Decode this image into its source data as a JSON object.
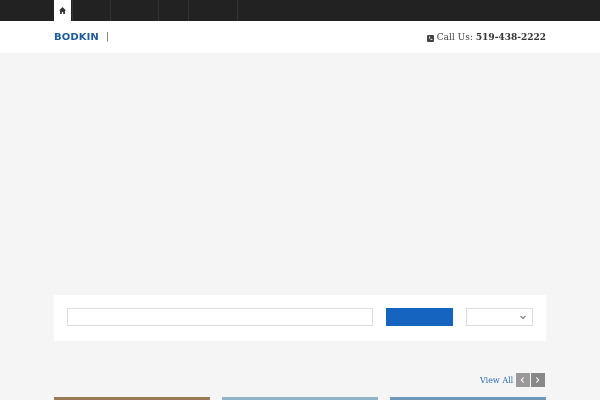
{
  "topnav": {
    "home_icon": "home-icon",
    "items": [
      "",
      "",
      "",
      "",
      ""
    ]
  },
  "header": {
    "logo": "BODKIN",
    "separator": "|",
    "phone_icon": "phone-icon",
    "phone_label": "Call Us:",
    "phone_number": "519-438-2222"
  },
  "search": {
    "input_value": "",
    "placeholder": "",
    "button_label": "",
    "select_value": "",
    "select_icon": "chevron-down-icon"
  },
  "listings": {
    "view_all": "View All",
    "prev_icon": "chevron-left-icon",
    "next_icon": "chevron-right-icon"
  },
  "colors": {
    "topbar": "#222222",
    "brand": "#1e5b9a",
    "button": "#1565c0",
    "background": "#f5f5f5"
  }
}
